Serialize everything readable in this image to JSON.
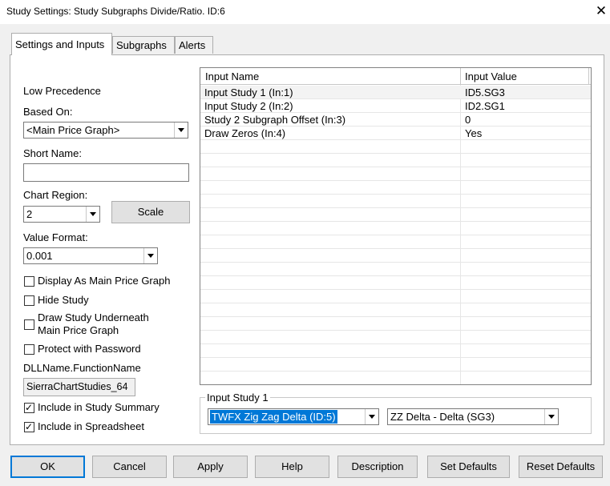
{
  "window": {
    "title": "Study Settings: Study Subgraphs Divide/Ratio. ID:6",
    "close_glyph": "✕"
  },
  "tabs": [
    {
      "label": "Settings and Inputs",
      "active": true
    },
    {
      "label": "Subgraphs",
      "active": false
    },
    {
      "label": "Alerts",
      "active": false
    }
  ],
  "left": {
    "precedence": "Low Precedence",
    "based_on_label": "Based On:",
    "based_on_value": "<Main Price Graph>",
    "short_name_label": "Short Name:",
    "short_name_value": "",
    "chart_region_label": "Chart Region:",
    "chart_region_value": "2",
    "scale_button": "Scale",
    "value_format_label": "Value Format:",
    "value_format_value": "0.001",
    "checkboxes": [
      {
        "label": "Display As Main Price Graph",
        "checked": false
      },
      {
        "label": "Hide Study",
        "checked": false
      },
      {
        "label": "Draw Study Underneath",
        "label2": "Main Price Graph",
        "checked": false
      },
      {
        "label": "Protect with Password",
        "checked": false
      }
    ],
    "dll_label": "DLLName.FunctionName",
    "dll_value": "SierraChartStudies_64",
    "include_summary": {
      "label": "Include in Study Summary",
      "checked": true
    },
    "include_spreadsheet": {
      "label": "Include in Spreadsheet",
      "checked": true
    },
    "check_glyph": "✓"
  },
  "inputs_grid": {
    "columns": [
      "Input Name",
      "Input Value"
    ],
    "rows": [
      {
        "name": "Input Study 1   (In:1)",
        "value": "ID5.SG3"
      },
      {
        "name": "Input Study 2   (In:2)",
        "value": "ID2.SG1"
      },
      {
        "name": "Study 2 Subgraph Offset   (In:3)",
        "value": "0"
      },
      {
        "name": "Draw Zeros   (In:4)",
        "value": "Yes"
      }
    ]
  },
  "input_editor": {
    "group_title": "Input Study 1",
    "study_value": "TWFX Zig Zag Delta (ID:5)",
    "subgraph_value": "ZZ Delta - Delta (SG3)"
  },
  "bottom_buttons": {
    "ok": "OK",
    "cancel": "Cancel",
    "apply": "Apply",
    "help": "Help",
    "description": "Description",
    "set_defaults": "Set Defaults",
    "reset_defaults": "Reset Defaults"
  },
  "colors": {
    "selection": "#0078d7",
    "dialog_bg": "#f0f0f0",
    "panel_bg": "#ffffff"
  }
}
